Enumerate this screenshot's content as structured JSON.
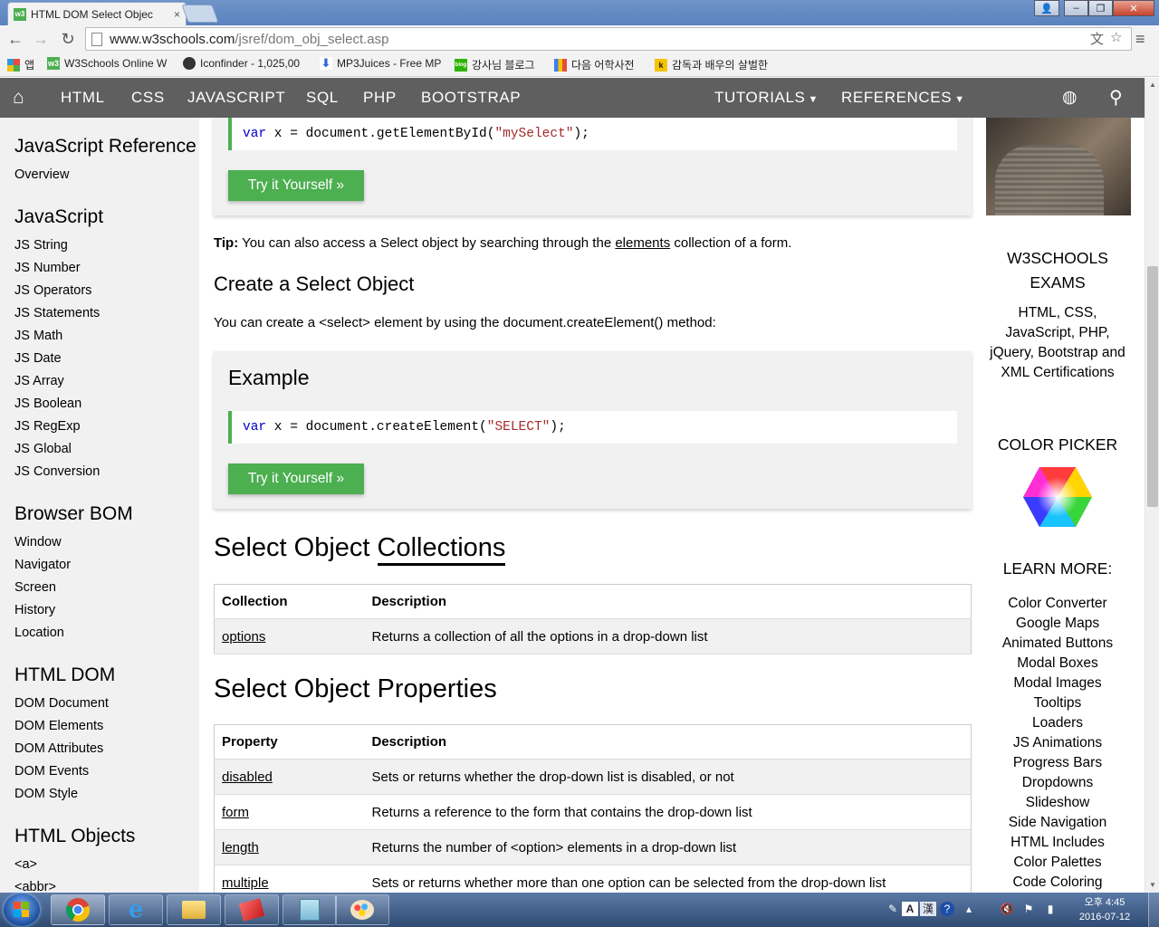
{
  "browser": {
    "tab_title": "HTML DOM Select Objec",
    "url_host": "www.w3schools.com",
    "url_path": "/jsref/dom_obj_select.asp",
    "bookmarks": [
      {
        "label": "앱",
        "icon": "apps-grid-icon",
        "color": "#e74c3c"
      },
      {
        "label": "W3Schools Online W",
        "icon": "w3schools-icon",
        "color": "#4caf50"
      },
      {
        "label": "Iconfinder - 1,025,00",
        "icon": "iconfinder-icon",
        "color": "#333333"
      },
      {
        "label": "MP3Juices - Free MP",
        "icon": "download-icon",
        "color": "#2e6bd6"
      },
      {
        "label": "강사님 블로그",
        "icon": "blog-icon",
        "color": "#2db400"
      },
      {
        "label": "다음 어학사전",
        "icon": "daum-icon",
        "color": "#3f7ff0"
      },
      {
        "label": "감독과 배우의 살벌한",
        "icon": "k-icon",
        "color": "#f5c400"
      }
    ]
  },
  "topnav": {
    "items": [
      "HTML",
      "CSS",
      "JAVASCRIPT",
      "SQL",
      "PHP",
      "BOOTSTRAP"
    ],
    "tutorials": "TUTORIALS",
    "references": "REFERENCES"
  },
  "sidebar": {
    "title": "JavaScript Reference",
    "overview": "Overview",
    "sections": [
      {
        "heading": "JavaScript",
        "links": [
          "JS String",
          "JS Number",
          "JS Operators",
          "JS Statements",
          "JS Math",
          "JS Date",
          "JS Array",
          "JS Boolean",
          "JS RegExp",
          "JS Global",
          "JS Conversion"
        ]
      },
      {
        "heading": "Browser BOM",
        "links": [
          "Window",
          "Navigator",
          "Screen",
          "History",
          "Location"
        ]
      },
      {
        "heading": "HTML DOM",
        "links": [
          "DOM Document",
          "DOM Elements",
          "DOM Attributes",
          "DOM Events",
          "DOM Style"
        ]
      },
      {
        "heading": "HTML Objects",
        "links": [
          "<a>",
          "<abbr>"
        ]
      }
    ]
  },
  "main": {
    "example1": {
      "code_kw": "var",
      "code_mid": " x = document.getElementById(",
      "code_str": "\"mySelect\"",
      "code_end": ");"
    },
    "try_label": "Try it Yourself »",
    "tip_bold": "Tip:",
    "tip_pre": " You can also access a Select object by searching through the ",
    "tip_link": "elements",
    "tip_post": " collection of a form.",
    "create_heading": "Create a Select Object",
    "create_text": "You can create a <select> element by using the document.createElement() method:",
    "example_title": "Example",
    "example2": {
      "code_kw": "var",
      "code_mid": " x = document.createElement(",
      "code_str": "\"SELECT\"",
      "code_end": ");"
    },
    "collections_heading_a": "Select Object",
    "collections_heading_b": "Collections",
    "collections_table": {
      "headers": [
        "Collection",
        "Description"
      ],
      "rows": [
        [
          "options",
          "Returns a collection of all the options in a drop-down list"
        ]
      ]
    },
    "properties_heading": "Select Object Properties",
    "properties_table": {
      "headers": [
        "Property",
        "Description"
      ],
      "rows": [
        [
          "disabled",
          "Sets or returns whether the drop-down list is disabled, or not"
        ],
        [
          "form",
          "Returns a reference to the form that contains the drop-down list"
        ],
        [
          "length",
          "Returns the number of <option> elements in a drop-down list"
        ],
        [
          "multiple",
          "Sets or returns whether more than one option can be selected from the drop-down list"
        ]
      ]
    }
  },
  "rightbar": {
    "exams_heading": "W3SCHOOLS EXAMS",
    "exams_text": "HTML, CSS, JavaScript, PHP, jQuery, Bootstrap and XML Certifications",
    "color_picker": "COLOR PICKER",
    "learn_more": "LEARN MORE:",
    "links": [
      "Color Converter",
      "Google Maps",
      "Animated Buttons",
      "Modal Boxes",
      "Modal Images",
      "Tooltips",
      "Loaders",
      "JS Animations",
      "Progress Bars",
      "Dropdowns",
      "Slideshow",
      "Side Navigation",
      "HTML Includes",
      "Color Palettes",
      "Code Coloring"
    ]
  },
  "taskbar": {
    "time": "오후 4:45",
    "date": "2016-07-12"
  },
  "colors": {
    "nav_bg": "#5f5f5f",
    "accent_green": "#4caf50",
    "panel_bg": "#f1f1f1"
  }
}
